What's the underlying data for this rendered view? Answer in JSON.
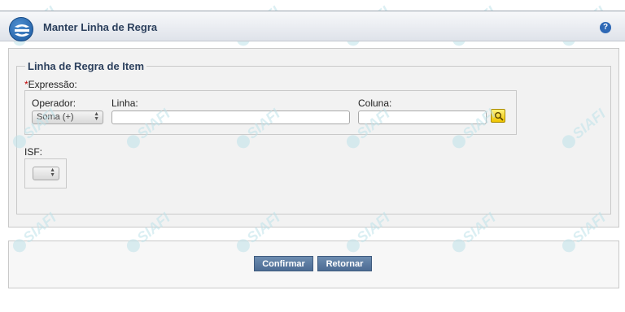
{
  "header": {
    "title": "Manter Linha de Regra",
    "help_label": "?",
    "logo_icon": "siafi-logo-icon"
  },
  "form": {
    "legend": "Linha de Regra de Item",
    "expression_required_mark": "*",
    "expression_label": "Expressão:",
    "operator_label": "Operador:",
    "operator_value": "Soma (+)",
    "line_label": "Linha:",
    "line_value": "",
    "column_label": "Coluna:",
    "column_value": "",
    "search_icon": "search-icon",
    "isf_label": "ISF:",
    "isf_value": ""
  },
  "footer": {
    "confirm_label": "Confirmar",
    "return_label": "Retornar"
  },
  "watermark_text": "SIAFI",
  "colors": {
    "accent": "#2b3f5c",
    "button": "#5a7aa0",
    "search_button": "#f5d000",
    "watermark": "#bfe3ea"
  }
}
